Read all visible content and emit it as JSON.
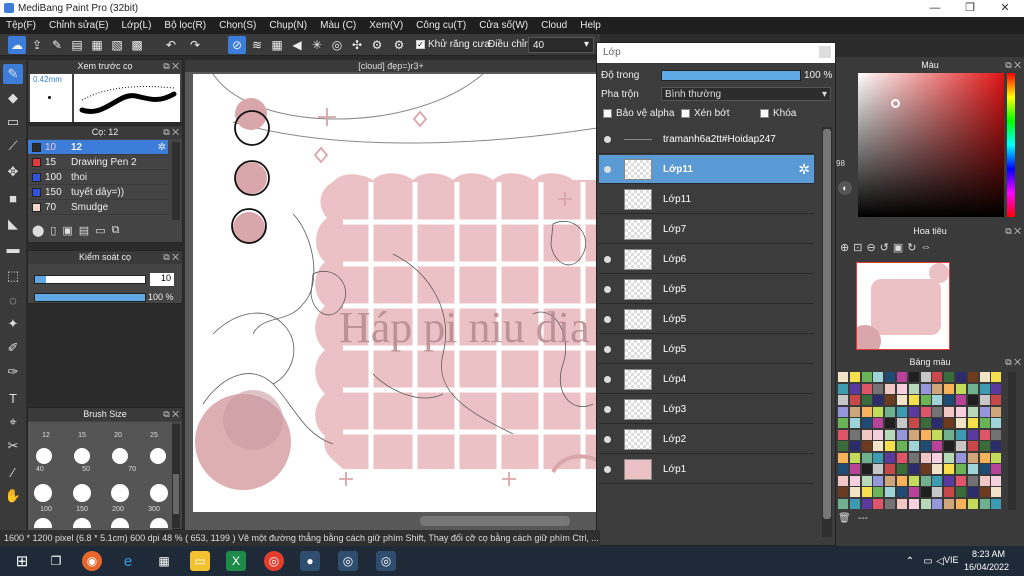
{
  "window": {
    "title": "MediBang Paint Pro (32bit)"
  },
  "menu": [
    "Tệp(F)",
    "Chỉnh sửa(E)",
    "Lớp(L)",
    "Bộ lọc(R)",
    "Chọn(S)",
    "Chụp(N)",
    "Màu (C)",
    "Xem(V)",
    "Công cụ(T)",
    "Cửa số(W)",
    "Cloud",
    "Help"
  ],
  "toolbar": {
    "antialias_label": "Khử răng cưa",
    "adjust_label": "Điều chỉnh",
    "adjust_value": "40"
  },
  "preview": {
    "title": "Xem trước cọ",
    "size_label": "0.42mm"
  },
  "brush": {
    "title": "Cọ: 12",
    "items": [
      {
        "size": "10",
        "name": "12",
        "color": "#2a2a2a",
        "selected": true
      },
      {
        "size": "15",
        "name": "Drawing Pen 2",
        "color": "#e03a3a"
      },
      {
        "size": "100",
        "name": "thoi",
        "color": "#3050e0"
      },
      {
        "size": "150",
        "name": "tuyết dây=))",
        "color": "#3050e0"
      },
      {
        "size": "70",
        "name": "Smudge",
        "color": "#f3d6c6"
      }
    ]
  },
  "control": {
    "title": "Kiểm soát cọ",
    "size_value": "10",
    "opacity_value": "100 %",
    "size_fraction": 0.1,
    "opacity_fraction": 1.0
  },
  "brushsize": {
    "title": "Brush Size",
    "labels_row1": [
      "12",
      "15",
      "20",
      "25"
    ],
    "labels_row2": [
      "40",
      "50",
      "70"
    ],
    "labels_row3": [
      "100",
      "150",
      "200",
      "300"
    ]
  },
  "document": {
    "tab": "[cloud] đẹp=)r3+",
    "text": "Háp pi niu dia"
  },
  "layers": {
    "title": "Lớp",
    "opacity_label": "Độ trong",
    "opacity_value": "100 %",
    "blend_label": "Pha trộn",
    "blend_value": "Bình thường",
    "protect_alpha": "Bảo vệ alpha",
    "clip": "Xén bớt",
    "lock": "Khóa",
    "items": [
      {
        "name": "tramanh6a2tt#Hoidap247",
        "visible": true,
        "selected": false
      },
      {
        "name": "Lớp11",
        "visible": true,
        "selected": true
      },
      {
        "name": "Lớp11",
        "visible": false,
        "selected": false
      },
      {
        "name": "Lớp7",
        "visible": false,
        "selected": false
      },
      {
        "name": "Lớp6",
        "visible": true,
        "selected": false
      },
      {
        "name": "Lớp5",
        "visible": true,
        "selected": false
      },
      {
        "name": "Lớp5",
        "visible": true,
        "selected": false
      },
      {
        "name": "Lớp5",
        "visible": true,
        "selected": false
      },
      {
        "name": "Lớp4",
        "visible": true,
        "selected": false
      },
      {
        "name": "Lớp3",
        "visible": true,
        "selected": false
      },
      {
        "name": "Lớp2",
        "visible": true,
        "selected": false
      },
      {
        "name": "Lớp1",
        "visible": true,
        "selected": false
      }
    ]
  },
  "color_panel": {
    "title": "Màu",
    "value_label": "98"
  },
  "navigator": {
    "title": "Hoa tiêu"
  },
  "palette": {
    "title": "Bảng màu",
    "footer": "---"
  },
  "status": {
    "text": "1600 * 1200 pixel  (6.8 * 5.1cm)  600 dpi  48 %  ( 653, 1199 )  Vẽ một đường thẳng bằng cách giữ phím Shift, Thay đổi cỡ cọ bằng cách giữ phím Ctrl, ..."
  },
  "taskbar": {
    "lang": "VIE",
    "time": "8:23 AM",
    "date": "16/04/2022"
  },
  "colors": {
    "accent": "#3b7dd8",
    "selected_layer": "#5b9bd5",
    "pink": "#ecc1c5",
    "pink_dark": "#d9a6ab"
  }
}
